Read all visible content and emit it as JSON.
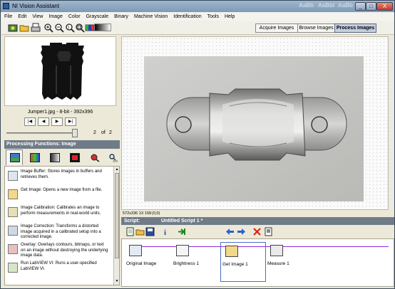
{
  "window": {
    "title": "NI Vision Assistant",
    "ghost_title": "AaBb",
    "ghost_title_2": "AaBbI",
    "controls": [
      "_",
      "□",
      "X"
    ]
  },
  "menu": [
    "File",
    "Edit",
    "View",
    "Image",
    "Color",
    "Grayscale",
    "Binary",
    "Machine Vision",
    "Identification",
    "Tools",
    "Help"
  ],
  "toolbar": {
    "icons": [
      "acquire-icon",
      "open-icon",
      "print-icon",
      "zoom-in-icon",
      "zoom-out-icon",
      "zoom-1to1-icon",
      "zoom-fit-icon",
      "palette-icon"
    ]
  },
  "modes": {
    "acquire": "Acquire Images",
    "browse": "Browse Images",
    "process": "Process Images",
    "active": "process"
  },
  "thumbnail": {
    "caption": "Jumper1.jpg - 8-bit - 392x396"
  },
  "navigator": {
    "buttons": [
      "|◀",
      "◀",
      "▶",
      "▶|"
    ],
    "current_page": "2",
    "of_label": "of",
    "total_pages": "2"
  },
  "processing": {
    "header": "Processing Functions: Image",
    "categories": [
      "image-icon",
      "color-icon",
      "grayscale-icon",
      "binary-icon",
      "machine-vision-icon",
      "identification-icon"
    ],
    "functions": [
      {
        "icon": "image-buffer-icon",
        "text": "Image Buffer:  Stores images in buffers and retrieves them."
      },
      {
        "icon": "get-image-icon",
        "text": "Get Image:  Opens a new image from a file."
      },
      {
        "icon": "image-calibration-icon",
        "text": "Image Calibration:  Calibrates an image to perform measurements in real-world units."
      },
      {
        "icon": "image-correction-icon",
        "text": "Image Correction:  Transforms a distorted image acquired in a calibrated setup into a corrected image."
      },
      {
        "icon": "overlay-icon",
        "text": "Overlay:  Overlays contours, bitmaps, or text on an image without destroying the underlying image data."
      },
      {
        "icon": "run-labview-icon",
        "text": "Run LabVIEW VI:  Runs a user-specified LabVIEW VI."
      }
    ]
  },
  "status": {
    "dims": "572x336 1X 158",
    "coords": "(0,0)"
  },
  "script": {
    "label": "Script:",
    "title": "Untitled Script 1 *",
    "toolbar_icons": [
      "new-script-icon",
      "open-script-icon",
      "save-script-icon",
      "info-icon",
      "run-icon",
      "step-back-icon",
      "step-forward-icon",
      "delete-step-icon",
      "properties-icon"
    ],
    "steps": [
      {
        "label": "Original Image",
        "selected": false
      },
      {
        "label": "Brightness 1",
        "selected": false
      },
      {
        "label": "Get Image 1",
        "selected": true
      },
      {
        "label": "Measure 1",
        "selected": false
      }
    ]
  },
  "colors": {
    "panel_header": "#6f7c88",
    "selection": "#4a6fc6",
    "script_line": "#8a2be2"
  }
}
